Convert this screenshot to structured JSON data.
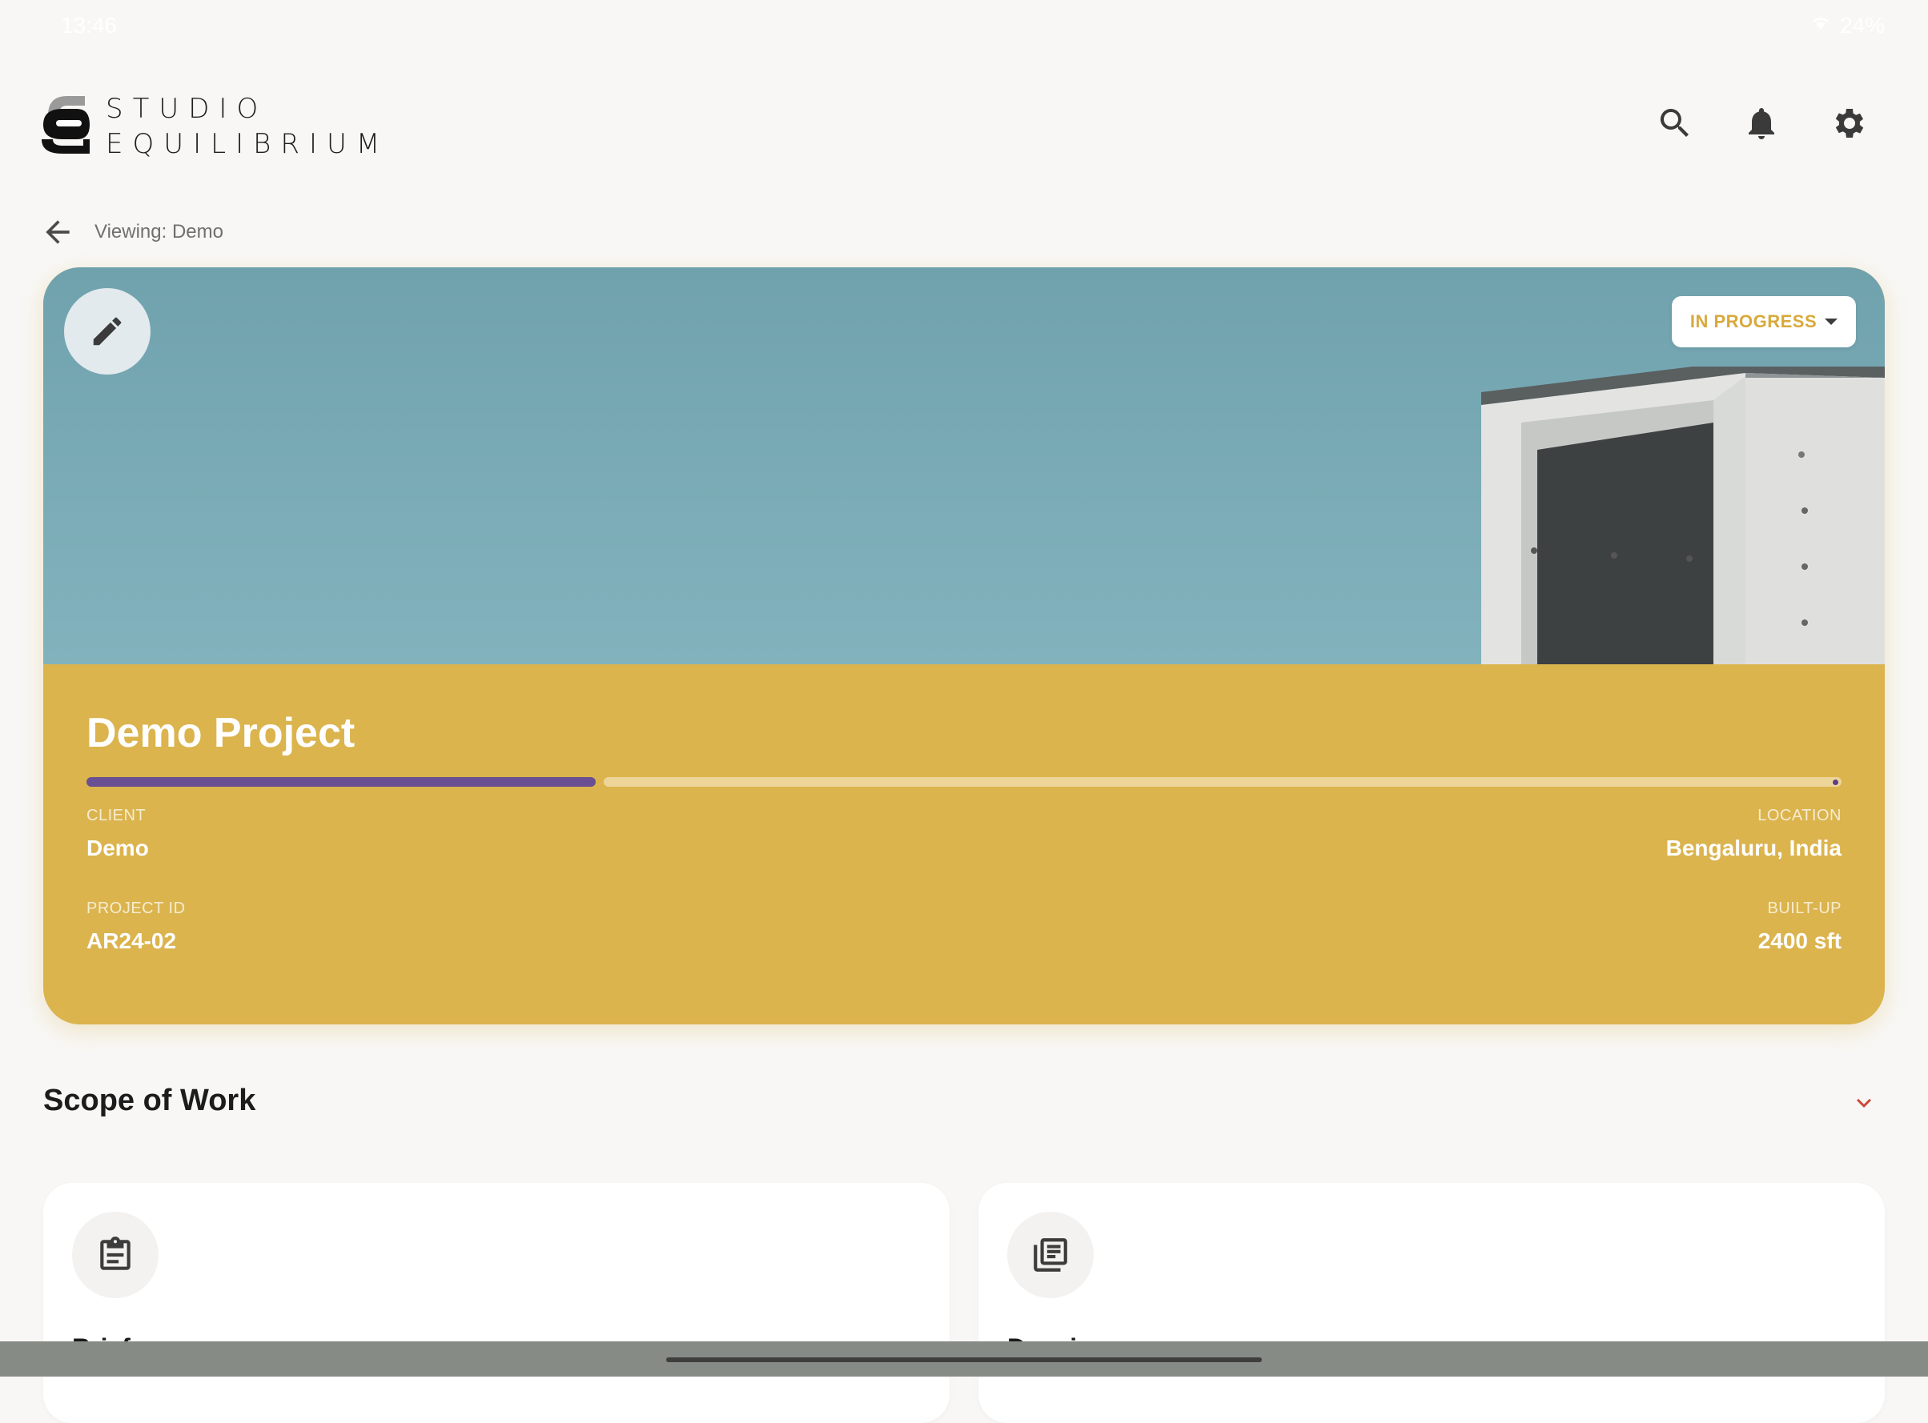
{
  "status_bar": {
    "time": "13:46",
    "battery": "24%"
  },
  "header": {
    "brand_line1": "STUDIO",
    "brand_line2": "EQUILIBRIUM",
    "icons": [
      "search-icon",
      "bell-icon",
      "gear-icon"
    ]
  },
  "breadcrumb": {
    "text": "Viewing: Demo"
  },
  "project": {
    "status": "IN PROGRESS",
    "title": "Demo Project",
    "progress_percent": 29,
    "client_label": "CLIENT",
    "client": "Demo",
    "location_label": "LOCATION",
    "location": "Bengaluru, India",
    "project_id_label": "PROJECT ID",
    "project_id": "AR24-02",
    "builtup_label": "BUILT-UP",
    "builtup": "2400 sft"
  },
  "scope": {
    "title": "Scope of Work",
    "cards": [
      {
        "icon": "clipboard-icon",
        "label": "Brief"
      },
      {
        "icon": "documents-icon",
        "label": "Drawings"
      }
    ]
  },
  "colors": {
    "accent_yellow": "#dbb44e",
    "progress_purple": "#6a4f93",
    "sky": "#78aab6",
    "chevron_red": "#c84b3c"
  }
}
